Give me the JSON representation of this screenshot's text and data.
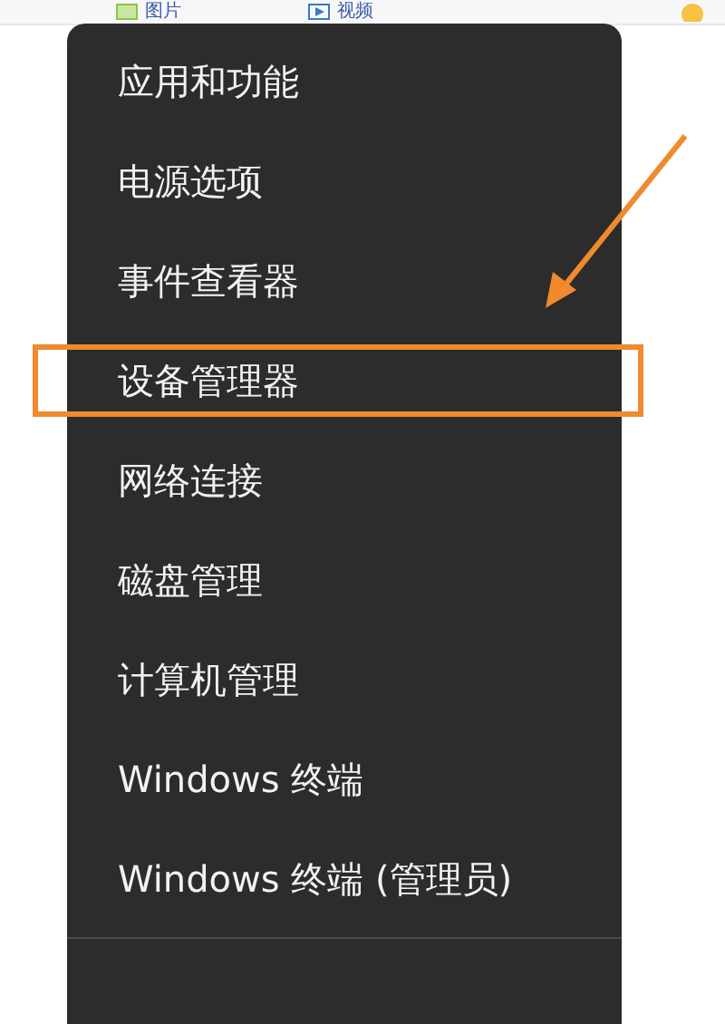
{
  "toolbar": {
    "items": [
      "图片",
      "视频"
    ]
  },
  "menu": {
    "items": [
      {
        "label": "应用和功能",
        "highlighted": false
      },
      {
        "label": "电源选项",
        "highlighted": false
      },
      {
        "label": "事件查看器",
        "highlighted": false
      },
      {
        "label": "设备管理器",
        "highlighted": true
      },
      {
        "label": "网络连接",
        "highlighted": false
      },
      {
        "label": "磁盘管理",
        "highlighted": false
      },
      {
        "label": "计算机管理",
        "highlighted": false
      },
      {
        "label": "Windows 终端",
        "highlighted": false
      },
      {
        "label": "Windows 终端 (管理员)",
        "highlighted": false
      }
    ]
  }
}
